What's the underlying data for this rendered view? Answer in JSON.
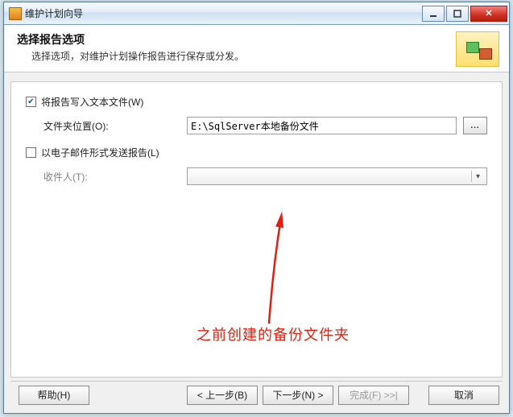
{
  "window": {
    "title": "维护计划向导"
  },
  "header": {
    "title": "选择报告选项",
    "subtitle": "选择选项，对维护计划操作报告进行保存或分发。"
  },
  "options": {
    "write_to_file": {
      "label": "将报告写入文本文件(W)",
      "checked": true
    },
    "folder_label": "文件夹位置(O):",
    "folder_value": "E:\\SqlServer本地备份文件",
    "browse_label": "...",
    "email_report": {
      "label": "以电子邮件形式发送报告(L)",
      "checked": false
    },
    "recipient_label": "收件人(T):"
  },
  "annotation": "之前创建的备份文件夹",
  "buttons": {
    "help": "帮助(H)",
    "back": "< 上一步(B)",
    "next": "下一步(N) >",
    "finish": "完成(F) >>|",
    "cancel": "取消"
  }
}
